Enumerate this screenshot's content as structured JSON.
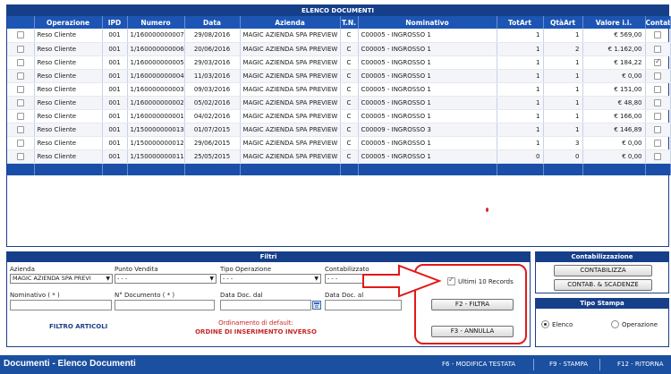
{
  "list": {
    "title": "ELENCO DOCUMENTI",
    "columns": [
      "",
      "Operazione",
      "IPD",
      "Numero",
      "Data",
      "Azienda",
      "T.N.",
      "Nominativo",
      "TotArt",
      "QtàArt",
      "Valore i.i.",
      "Contab"
    ],
    "rows": [
      {
        "operazione": "Reso Cliente",
        "ipd": "001",
        "numero": "1/160000000007",
        "data": "29/08/2016",
        "azienda": "MAGIC AZIENDA SPA PREVIEW",
        "tn": "C",
        "nominativo": "C00005 - INGROSSO 1",
        "totart": "1",
        "qtaart": "1",
        "valore": "€ 569,00",
        "contab": false
      },
      {
        "operazione": "Reso Cliente",
        "ipd": "001",
        "numero": "1/160000000006",
        "data": "20/06/2016",
        "azienda": "MAGIC AZIENDA SPA PREVIEW",
        "tn": "C",
        "nominativo": "C00005 - INGROSSO 1",
        "totart": "1",
        "qtaart": "2",
        "valore": "€ 1.162,00",
        "contab": false
      },
      {
        "operazione": "Reso Cliente",
        "ipd": "001",
        "numero": "1/160000000005",
        "data": "29/03/2016",
        "azienda": "MAGIC AZIENDA SPA PREVIEW",
        "tn": "C",
        "nominativo": "C00005 - INGROSSO 1",
        "totart": "1",
        "qtaart": "1",
        "valore": "€ 184,22",
        "contab": true
      },
      {
        "operazione": "Reso Cliente",
        "ipd": "001",
        "numero": "1/160000000004",
        "data": "11/03/2016",
        "azienda": "MAGIC AZIENDA SPA PREVIEW",
        "tn": "C",
        "nominativo": "C00005 - INGROSSO 1",
        "totart": "1",
        "qtaart": "1",
        "valore": "€ 0,00",
        "contab": false
      },
      {
        "operazione": "Reso Cliente",
        "ipd": "001",
        "numero": "1/160000000003",
        "data": "09/03/2016",
        "azienda": "MAGIC AZIENDA SPA PREVIEW",
        "tn": "C",
        "nominativo": "C00005 - INGROSSO 1",
        "totart": "1",
        "qtaart": "1",
        "valore": "€ 151,00",
        "contab": false
      },
      {
        "operazione": "Reso Cliente",
        "ipd": "001",
        "numero": "1/160000000002",
        "data": "05/02/2016",
        "azienda": "MAGIC AZIENDA SPA PREVIEW",
        "tn": "C",
        "nominativo": "C00005 - INGROSSO 1",
        "totart": "1",
        "qtaart": "1",
        "valore": "€ 48,80",
        "contab": false
      },
      {
        "operazione": "Reso Cliente",
        "ipd": "001",
        "numero": "1/160000000001",
        "data": "04/02/2016",
        "azienda": "MAGIC AZIENDA SPA PREVIEW",
        "tn": "C",
        "nominativo": "C00005 - INGROSSO 1",
        "totart": "1",
        "qtaart": "1",
        "valore": "€ 166,00",
        "contab": false
      },
      {
        "operazione": "Reso Cliente",
        "ipd": "001",
        "numero": "1/150000000013",
        "data": "01/07/2015",
        "azienda": "MAGIC AZIENDA SPA PREVIEW",
        "tn": "C",
        "nominativo": "C00009 - INGROSSO 3",
        "totart": "1",
        "qtaart": "1",
        "valore": "€ 146,89",
        "contab": false
      },
      {
        "operazione": "Reso Cliente",
        "ipd": "001",
        "numero": "1/150000000012",
        "data": "29/06/2015",
        "azienda": "MAGIC AZIENDA SPA PREVIEW",
        "tn": "C",
        "nominativo": "C00005 - INGROSSO 1",
        "totart": "1",
        "qtaart": "3",
        "valore": "€ 0,00",
        "contab": false
      },
      {
        "operazione": "Reso Cliente",
        "ipd": "001",
        "numero": "1/150000000011",
        "data": "25/05/2015",
        "azienda": "MAGIC AZIENDA SPA PREVIEW",
        "tn": "C",
        "nominativo": "C00005 - INGROSSO 1",
        "totart": "0",
        "qtaart": "0",
        "valore": "€ 0,00",
        "contab": false
      }
    ]
  },
  "filtri": {
    "title": "Filtri",
    "azienda_label": "Azienda",
    "azienda_value": "MAGIC AZIENDA SPA PREVI",
    "punto_vendita_label": "Punto Vendita",
    "punto_vendita_value": "- - -",
    "tipo_operazione_label": "Tipo Operazione",
    "tipo_operazione_value": "- - -",
    "contabilizzato_label": "Contabilizzato",
    "contabilizzato_value": "- - -",
    "nominativo_label": "Nominativo ( * )",
    "n_documento_label": "N° Documento ( * )",
    "data_dal_label": "Data Doc. dal",
    "data_al_label": "Data Doc. al",
    "ultimi_records_label": "Ultimi 10 Records",
    "ultimi_records_checked": true,
    "filtra_button": "F2 - FILTRA",
    "annulla_button": "F3 - ANNULLA",
    "filtro_articoli": "FILTRO ARTICOLI",
    "ordinamento_line1": "Ordinamento di default:",
    "ordinamento_line2": "ORDINE DI INSERIMENTO INVERSO"
  },
  "contabilizzazione": {
    "title": "Contabilizzazione",
    "contabilizza_button": "CONTABILIZZA",
    "contab_scadenze_button": "CONTAB. & SCADENZE"
  },
  "tipo_stampa": {
    "title": "Tipo Stampa",
    "elenco_label": "Elenco",
    "operazione_label": "Operazione",
    "selected": "Elenco"
  },
  "statusbar": {
    "title": "Documenti - Elenco Documenti",
    "f6": "F6 - MODIFICA TESTATA",
    "f9": "F9 - STAMPA",
    "f12": "F12 - RITORNA"
  },
  "colors": {
    "header_dark": "#163f8a",
    "header_blue": "#1d55b4",
    "statusbar": "#1b4fa0",
    "annotation_red": "#e01a1a",
    "ordinamento_red": "#c62828"
  }
}
